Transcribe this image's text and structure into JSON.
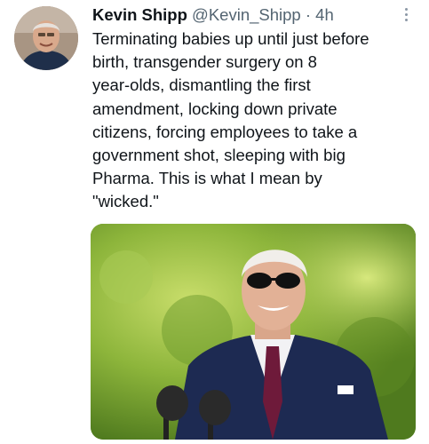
{
  "tweet": {
    "author_name": "Kevin Shipp",
    "author_handle": "@Kevin_Shipp",
    "separator": "·",
    "time": "4h",
    "text": "Terminating babies up until just before\nbirth, transgender surgery on 8\nyear-olds, dismantling the first\namendment, locking down private\ncitizens, forcing employees to take a\ngovernment shot, sleeping with big\nPharma. This is what I mean by\n\"wicked.\"",
    "avatar_icon": "user-avatar",
    "more_icon": "more-vertical-icon",
    "media_icon": "photo"
  },
  "colors": {
    "text": "#0f1419",
    "secondary": "#536471",
    "background": "#ffffff"
  }
}
